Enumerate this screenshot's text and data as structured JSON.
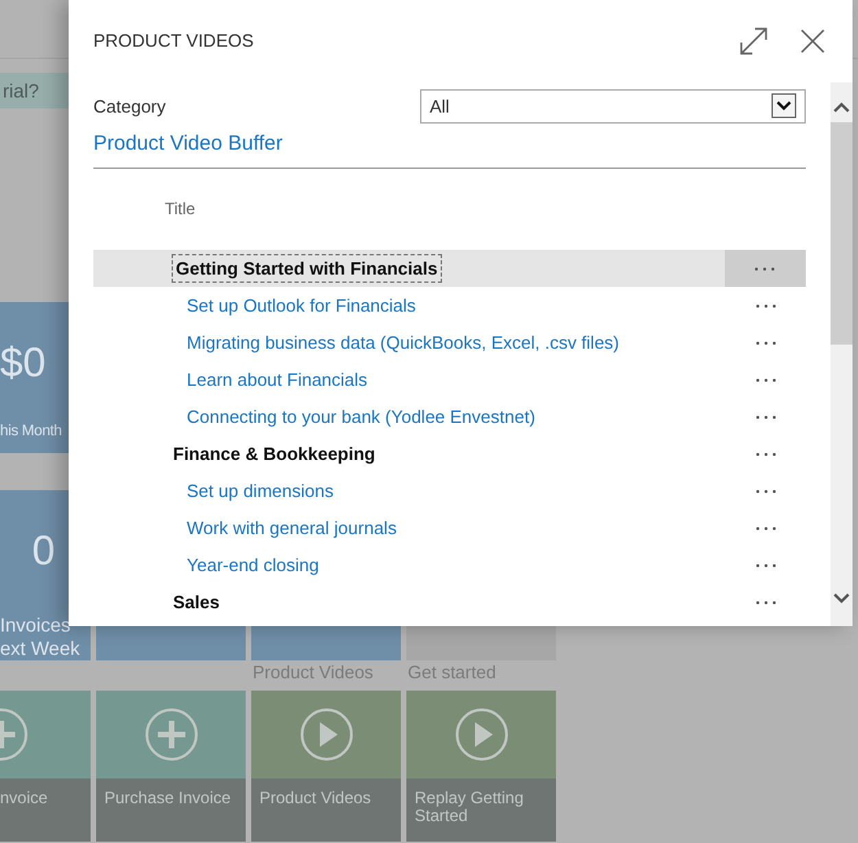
{
  "background": {
    "banner": {
      "text": "rial?"
    },
    "tiles_top": [
      {
        "kind": "cue",
        "value": "$0",
        "lines": [
          "his Month"
        ]
      }
    ],
    "tiles_mid": [
      {
        "kind": "cue",
        "value": "0",
        "lines": [
          "Invoices",
          "ext Week"
        ]
      },
      {
        "kind": "cue"
      },
      {
        "kind": "cue"
      },
      {
        "kind": "neutral"
      }
    ],
    "tiles_actions": [
      {
        "kind": "add",
        "label": "nvoice"
      },
      {
        "kind": "add",
        "label": "Purchase Invoice"
      },
      {
        "kind": "play",
        "heading": "Product Videos",
        "label": "Product Videos"
      },
      {
        "kind": "play",
        "heading": "Get started",
        "label": "Replay Getting Started"
      }
    ]
  },
  "dialog": {
    "title": "PRODUCT VIDEOS",
    "category": {
      "label": "Category",
      "value": "All"
    },
    "subtitle": "Product Video Buffer",
    "column": "Title",
    "rows": [
      {
        "title": "Getting Started with Financials",
        "selected": true,
        "children": [
          {
            "title": "Set up Outlook for Financials",
            "selected": false
          },
          {
            "title": "Migrating business data (QuickBooks, Excel, .csv files)",
            "selected": false
          },
          {
            "title": "Learn about Financials",
            "selected": false
          },
          {
            "title": "Connecting to your bank (Yodlee Envestnet)",
            "selected": false
          }
        ]
      },
      {
        "title": "Finance & Bookkeeping",
        "selected": false,
        "children": [
          {
            "title": "Set up dimensions",
            "selected": false
          },
          {
            "title": "Work with general journals",
            "selected": false
          },
          {
            "title": "Year-end closing",
            "selected": false
          }
        ]
      },
      {
        "title": "Sales",
        "selected": false
      }
    ]
  }
}
